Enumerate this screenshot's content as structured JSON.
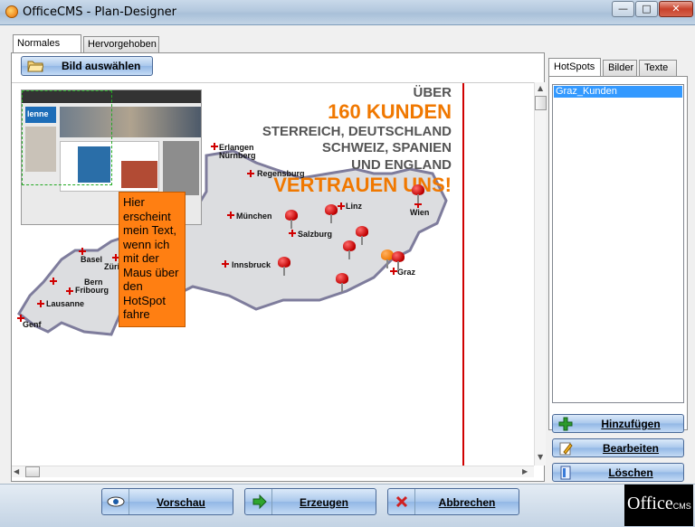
{
  "window": {
    "title": "OfficeCMS - Plan-Designer",
    "minimize": "—",
    "maximize": "□",
    "close": "✕"
  },
  "tabs": [
    {
      "label": "Normales Bild",
      "active": true
    },
    {
      "label": "Hervorgehoben",
      "active": false
    }
  ],
  "toolbar": {
    "select_image_label": "Bild auswählen",
    "icon": "folder-open-icon"
  },
  "map": {
    "headline": [
      "ÜBER",
      "160 KUNDEN",
      "STERREICH, DEUTSCHLAND",
      "SCHWEIZ, SPANIEN",
      "UND ENGLAND",
      "VERTRAUEN UNS!"
    ],
    "cities": [
      "Erlangen",
      "Nürnberg",
      "Regensburg",
      "München",
      "Linz",
      "Wien",
      "Salzburg",
      "Basel",
      "Zürich",
      "Innsbruck",
      "Graz",
      "Bern",
      "Fribourg",
      "Lausanne",
      "Genf"
    ],
    "tooltip_text": "Hier erscheint mein Text, wenn ich mit der Maus über den HotSpot fahre",
    "accent_color": "#f07800",
    "pin_color": "#d00000"
  },
  "side_tabs": [
    {
      "label": "HotSpots",
      "active": true
    },
    {
      "label": "Bilder",
      "active": false
    },
    {
      "label": "Texte",
      "active": false
    }
  ],
  "hotspots": [
    {
      "label": "Graz_Kunden",
      "selected": true
    }
  ],
  "actions": {
    "add": "Hinzufügen",
    "edit": "Bearbeiten",
    "delete": "Löschen"
  },
  "bottom": {
    "preview": "Vorschau",
    "generate": "Erzeugen",
    "cancel": "Abbrechen"
  },
  "logo": {
    "text": "Office",
    "sub": "CMS"
  }
}
